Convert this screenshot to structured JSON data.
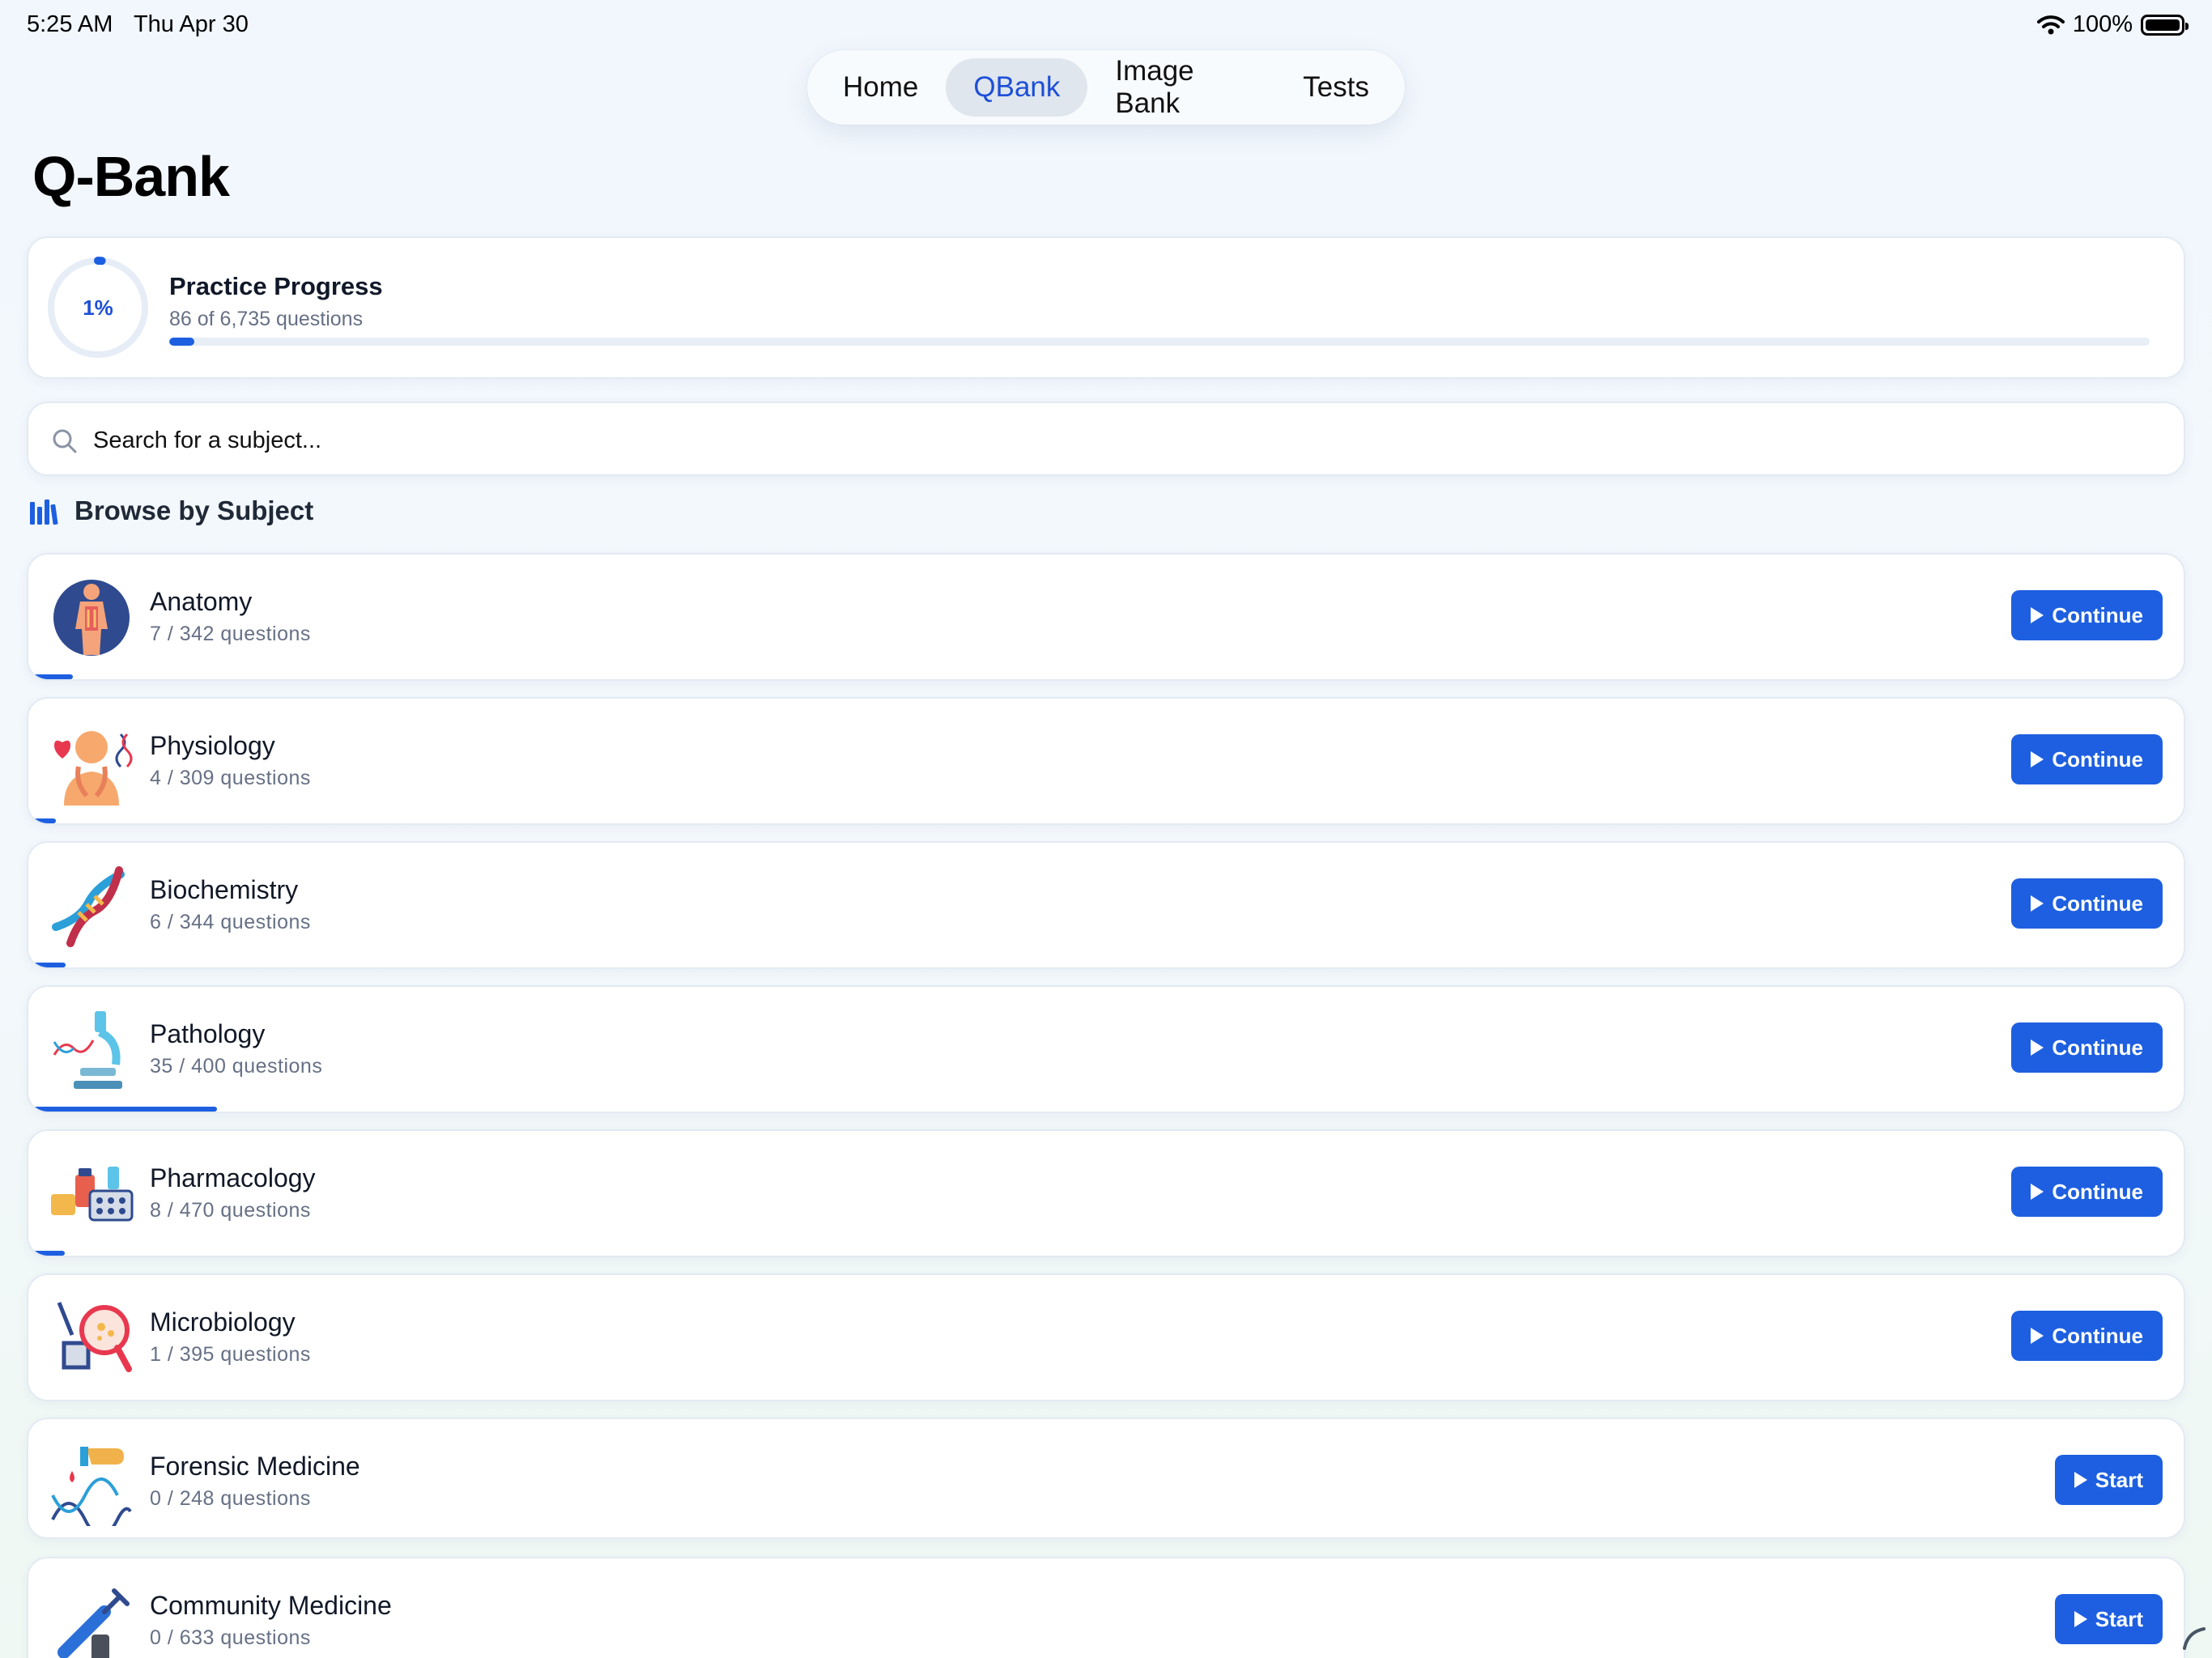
{
  "status_bar": {
    "time": "5:25 AM",
    "date": "Thu Apr 30",
    "battery": "100%"
  },
  "nav": {
    "tabs": [
      {
        "label": "Home",
        "active": false
      },
      {
        "label": "QBank",
        "active": true
      },
      {
        "label": "Image Bank",
        "active": false
      },
      {
        "label": "Tests",
        "active": false
      }
    ]
  },
  "page": {
    "title": "Q-Bank"
  },
  "progress": {
    "percent_label": "1%",
    "title": "Practice Progress",
    "subtitle": "86 of 6,735 questions",
    "fraction": 0.0128
  },
  "search": {
    "placeholder": "Search for a subject..."
  },
  "browse": {
    "title": "Browse by Subject"
  },
  "subjects": [
    {
      "name": "Anatomy",
      "count": "7 / 342 questions",
      "fraction": 0.0205,
      "action": "Continue",
      "icon": "anatomy-icon"
    },
    {
      "name": "Physiology",
      "count": "4 / 309 questions",
      "fraction": 0.0129,
      "action": "Continue",
      "icon": "physiology-icon"
    },
    {
      "name": "Biochemistry",
      "count": "6 / 344 questions",
      "fraction": 0.0174,
      "action": "Continue",
      "icon": "dna-icon"
    },
    {
      "name": "Pathology",
      "count": "35 / 400 questions",
      "fraction": 0.0875,
      "action": "Continue",
      "icon": "microscope-icon"
    },
    {
      "name": "Pharmacology",
      "count": "8 / 470 questions",
      "fraction": 0.017,
      "action": "Continue",
      "icon": "pills-icon"
    },
    {
      "name": "Microbiology",
      "count": "1 / 395 questions",
      "fraction": 0.0025,
      "action": "Continue",
      "icon": "bacteria-icon"
    },
    {
      "name": "Forensic Medicine",
      "count": "0 / 248 questions",
      "fraction": 0,
      "action": "Start",
      "icon": "fingerprint-dna-icon"
    },
    {
      "name": "Community Medicine",
      "count": "0 / 633 questions",
      "fraction": 0,
      "action": "Start",
      "icon": "syringe-icon"
    }
  ],
  "colors": {
    "accent": "#1d5fe0",
    "active_tab_text": "#1d4fd8"
  }
}
